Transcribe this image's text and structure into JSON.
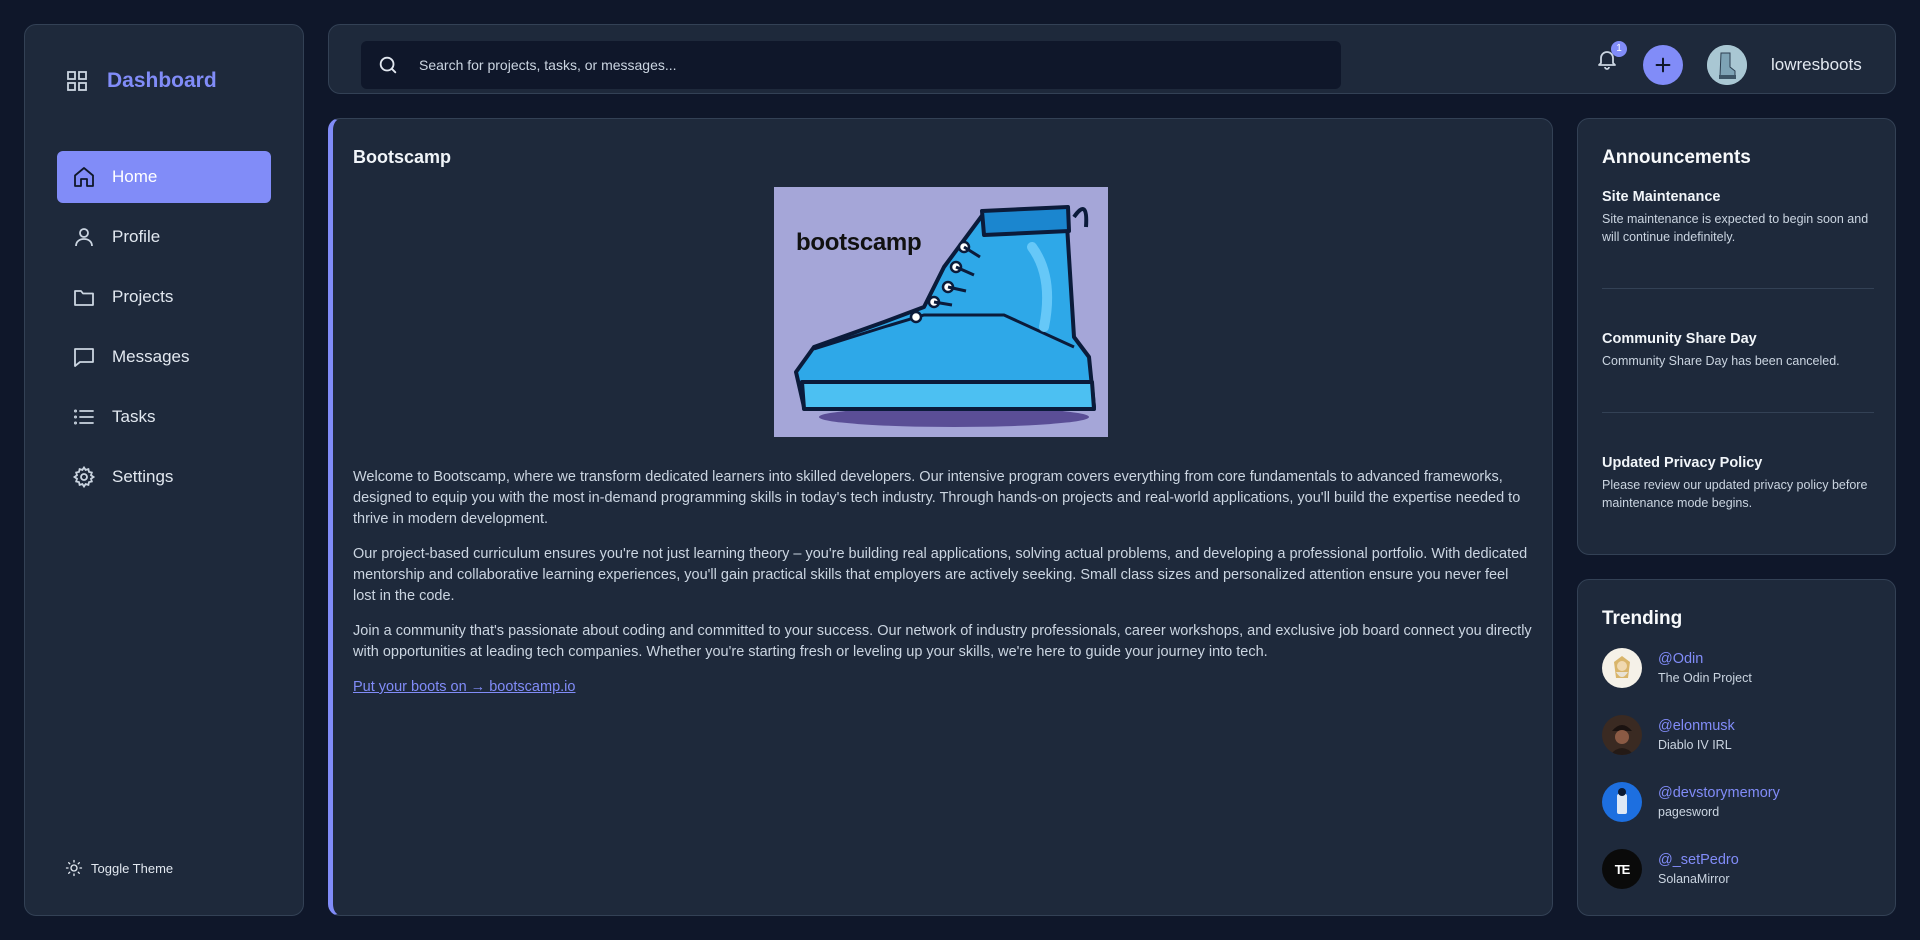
{
  "sidebar": {
    "title": "Dashboard",
    "items": [
      {
        "label": "Home",
        "icon": "home-icon",
        "active": true
      },
      {
        "label": "Profile",
        "icon": "user-icon"
      },
      {
        "label": "Projects",
        "icon": "folder-icon"
      },
      {
        "label": "Messages",
        "icon": "message-icon"
      },
      {
        "label": "Tasks",
        "icon": "list-icon"
      },
      {
        "label": "Settings",
        "icon": "gear-icon"
      }
    ],
    "toggle_theme": "Toggle Theme"
  },
  "header": {
    "search_placeholder": "Search for projects, tasks, or messages...",
    "notification_count": "1",
    "username": "lowresboots"
  },
  "main": {
    "title": "Bootscamp",
    "hero_text": "bootscamp",
    "paragraphs": [
      "Welcome to Bootscamp, where we transform dedicated learners into skilled developers. Our intensive program covers everything from core fundamentals to advanced frameworks, designed to equip you with the most in-demand programming skills in today's tech industry. Through hands-on projects and real-world applications, you'll build the expertise needed to thrive in modern development.",
      "Our project-based curriculum ensures you're not just learning theory – you're building real applications, solving actual problems, and developing a professional portfolio. With dedicated mentorship and collaborative learning experiences, you'll gain practical skills that employers are actively seeking. Small class sizes and personalized attention ensure you never feel lost in the code.",
      "Join a community that's passionate about coding and committed to your success. Our network of industry professionals, career workshops, and exclusive job board connect you directly with opportunities at leading tech companies. Whether you're starting fresh or leveling up your skills, we're here to guide your journey into tech."
    ],
    "cta_link": "Put your boots on → bootscamp.io"
  },
  "announcements": {
    "title": "Announcements",
    "items": [
      {
        "title": "Site Maintenance",
        "body": "Site maintenance is expected to begin soon and will continue indefinitely."
      },
      {
        "title": "Community Share Day",
        "body": "Community Share Day has been canceled."
      },
      {
        "title": "Updated Privacy Policy",
        "body": "Please review our updated privacy policy before maintenance mode begins."
      }
    ]
  },
  "trending": {
    "title": "Trending",
    "items": [
      {
        "handle": "@Odin",
        "sub": "The Odin Project"
      },
      {
        "handle": "@elonmusk",
        "sub": "Diablo IV IRL"
      },
      {
        "handle": "@devstorymemory",
        "sub": "pagesword"
      },
      {
        "handle": "@_setPedro",
        "sub": "SolanaMirror",
        "avatar_text": "TE"
      }
    ]
  },
  "colors": {
    "accent": "#818cf8",
    "background": "#0f172a",
    "panel": "#1e293b"
  }
}
